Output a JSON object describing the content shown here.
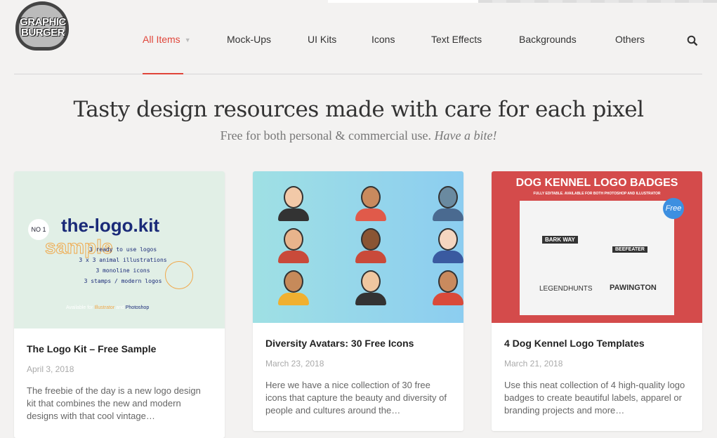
{
  "brand": {
    "logo_text_line1": "GRAPHIC",
    "logo_text_line2": "BURGER"
  },
  "nav": {
    "items": [
      {
        "label": "All Items",
        "active": true,
        "has_dropdown": true
      },
      {
        "label": "Mock-Ups"
      },
      {
        "label": "UI Kits"
      },
      {
        "label": "Icons"
      },
      {
        "label": "Text Effects"
      },
      {
        "label": "Backgrounds"
      },
      {
        "label": "Others"
      }
    ],
    "search_icon": "search-icon"
  },
  "hero": {
    "title": "Tasty design resources made with care for each pixel",
    "subtitle": "Free for both personal & commercial use.",
    "subtitle_em": "Have a bite!"
  },
  "colors": {
    "accent": "#e0453a",
    "background": "#f3f2f1"
  },
  "cards": [
    {
      "title": "The Logo Kit – Free Sample",
      "date": "April 3, 2018",
      "description": "The freebie of the day is a new logo design kit that combines the new and modern designs with that cool vintage…",
      "image": {
        "badge": "NO 1",
        "headline": "the-logo.kit",
        "overlay": "sample",
        "lines": [
          "3 ready to use logos",
          "3 x 3 animal illustrations",
          "3 monoline icons",
          "3 stamps / modern logos"
        ],
        "footer_prefix": "Available for",
        "footer_a": "Illustrator",
        "footer_and": "and",
        "footer_b": "Photoshop"
      }
    },
    {
      "title": "Diversity Avatars: 30 Free Icons",
      "date": "March 23, 2018",
      "description": "Here we have a nice collection of 30 free icons that capture the beauty and diversity of people and cultures around the…"
    },
    {
      "title": "4 Dog Kennel Logo Templates",
      "date": "March 21, 2018",
      "description": "Use this neat collection of 4 high-quality logo badges to create beautiful labels, apparel or branding projects and more…",
      "image": {
        "headline": "DOG KENNEL LOGO BADGES",
        "subhead": "FULLY EDITABLE. AVAILABLE FOR BOTH PHOTOSHOP AND ILLUSTRATOR",
        "badge": "Free",
        "logos": [
          "BARK WAY",
          "BEEFEATER",
          "LEGENDHUNTS",
          "PAWINGTON"
        ]
      }
    }
  ]
}
